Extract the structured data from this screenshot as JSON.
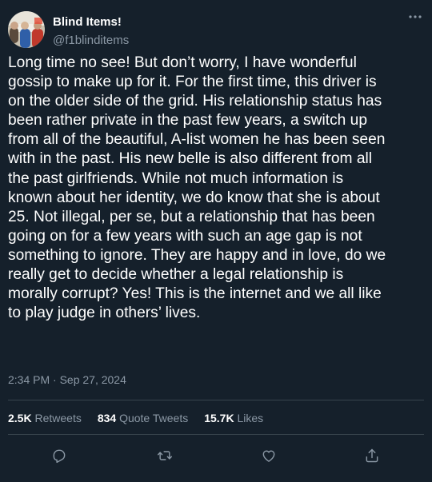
{
  "tweet": {
    "display_name": "Blind Items!",
    "handle": "@f1blinditems",
    "body_lines": [
      "Long time no see! But don’t worry, I have wonderful",
      "gossip to make up for it. For the first time, this driver is",
      "on the older side of the grid. His relationship status has",
      "been rather private in the past few years, a switch up",
      "from all of the beautiful, A-list women he has been seen",
      "with in the past. His new belle is also different from all",
      "the past girlfriends. While not much information is",
      "known about her identity, we do know that she is about",
      "25. Not illegal, per se, but a relationship that has been",
      "going on for a few years with such an age gap is not",
      "something to ignore. They are happy and in love, do we",
      "really get to decide whether a legal relationship is",
      "morally corrupt? Yes! This is the internet and we all like",
      "to play judge in others’ lives."
    ],
    "timestamp": "2:34 PM · Sep 27, 2024",
    "stats": {
      "retweets_count": "2.5K",
      "retweets_label": "Retweets",
      "quotes_count": "834",
      "quotes_label": "Quote Tweets",
      "likes_count": "15.7K",
      "likes_label": "Likes"
    },
    "actions": [
      "reply-icon",
      "retweet-icon",
      "like-icon",
      "share-icon"
    ],
    "colors": {
      "background": "#15202b",
      "text": "#ffffff",
      "secondary": "#8b98a5",
      "divider": "#38444d"
    }
  }
}
